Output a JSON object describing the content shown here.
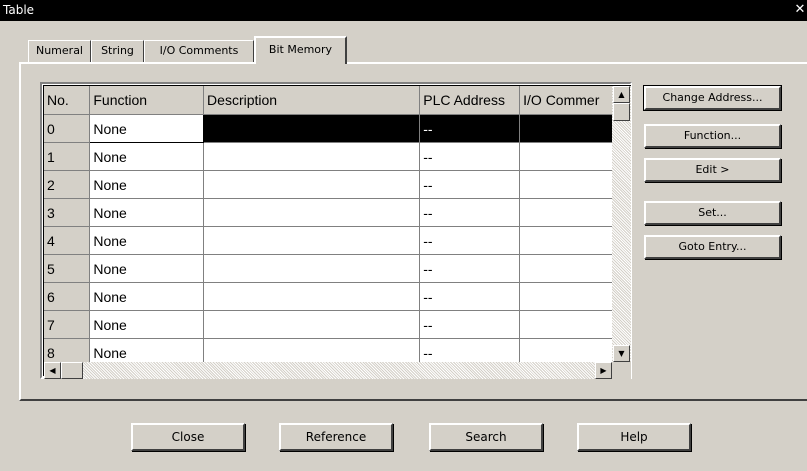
{
  "window": {
    "title": "Table",
    "close_glyph": "✕"
  },
  "tabs": [
    {
      "label": "Numeral"
    },
    {
      "label": "String"
    },
    {
      "label": "I/O Comments"
    },
    {
      "label": "Bit Memory"
    }
  ],
  "active_tab": "Bit Memory",
  "table": {
    "columns": [
      "No.",
      "Function",
      "Description",
      "PLC Address",
      "I/O Commer"
    ],
    "rows": [
      {
        "no": "0",
        "function": "None",
        "description": "",
        "plc_address": "--",
        "io_comment": "",
        "selected": true
      },
      {
        "no": "1",
        "function": "None",
        "description": "",
        "plc_address": "--",
        "io_comment": ""
      },
      {
        "no": "2",
        "function": "None",
        "description": "",
        "plc_address": "--",
        "io_comment": ""
      },
      {
        "no": "3",
        "function": "None",
        "description": "",
        "plc_address": "--",
        "io_comment": ""
      },
      {
        "no": "4",
        "function": "None",
        "description": "",
        "plc_address": "--",
        "io_comment": ""
      },
      {
        "no": "5",
        "function": "None",
        "description": "",
        "plc_address": "--",
        "io_comment": ""
      },
      {
        "no": "6",
        "function": "None",
        "description": "",
        "plc_address": "--",
        "io_comment": ""
      },
      {
        "no": "7",
        "function": "None",
        "description": "",
        "plc_address": "--",
        "io_comment": ""
      },
      {
        "no": "8",
        "function": "None",
        "description": "",
        "plc_address": "--",
        "io_comment": ""
      }
    ]
  },
  "side_buttons": {
    "change_address": "Change Address...",
    "function": "Function...",
    "edit": "Edit >",
    "set": "Set...",
    "goto_entry": "Goto Entry..."
  },
  "bottom_buttons": {
    "close": "Close",
    "reference": "Reference",
    "search": "Search",
    "help": "Help"
  },
  "scrollbar_glyphs": {
    "up": "▲",
    "down": "▼",
    "left": "◀",
    "right": "▶"
  }
}
